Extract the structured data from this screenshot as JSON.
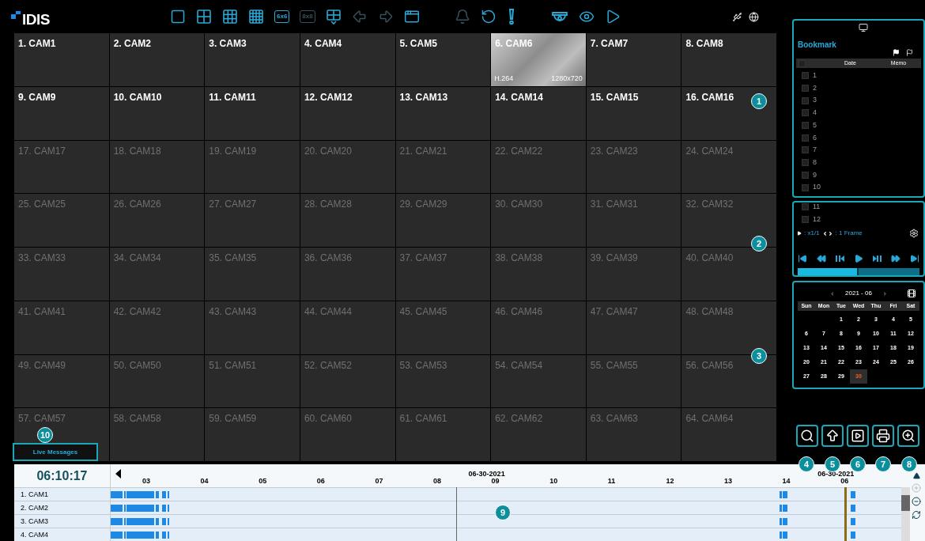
{
  "toolbar": {
    "logo": "IDIS",
    "groups": [
      [
        {
          "kind": "single",
          "disabled": false
        },
        {
          "kind": "quad",
          "disabled": false
        },
        {
          "kind": "grid9",
          "disabled": false
        },
        {
          "kind": "grid16",
          "disabled": false
        },
        {
          "kind": "label",
          "label": "6x6",
          "disabled": false
        },
        {
          "kind": "label",
          "label": "8x8",
          "disabled": true
        },
        {
          "kind": "custom",
          "disabled": false
        },
        {
          "kind": "prev",
          "disabled": true
        },
        {
          "kind": "next",
          "disabled": true
        },
        {
          "kind": "window",
          "disabled": false
        }
      ],
      [
        {
          "kind": "bell",
          "disabled": true
        },
        {
          "kind": "replay",
          "disabled": false
        },
        {
          "kind": "alert",
          "disabled": false
        }
      ],
      [
        {
          "kind": "dome",
          "disabled": false
        },
        {
          "kind": "eye",
          "disabled": false
        },
        {
          "kind": "play",
          "disabled": false
        }
      ]
    ]
  },
  "cameras": [
    {
      "name": "1. CAM1",
      "active": true
    },
    {
      "name": "2. CAM2",
      "active": true
    },
    {
      "name": "3. CAM3",
      "active": true
    },
    {
      "name": "4. CAM4",
      "active": true
    },
    {
      "name": "5. CAM5",
      "active": true
    },
    {
      "name": "6. CAM6",
      "active": true,
      "video": {
        "codec": "H.264",
        "resolution": "1280x720"
      }
    },
    {
      "name": "7. CAM7",
      "active": true
    },
    {
      "name": "8. CAM8",
      "active": true
    },
    {
      "name": "9. CAM9",
      "active": true
    },
    {
      "name": "10. CAM10",
      "active": true
    },
    {
      "name": "11. CAM11",
      "active": true
    },
    {
      "name": "12. CAM12",
      "active": true
    },
    {
      "name": "13. CAM13",
      "active": true
    },
    {
      "name": "14. CAM14",
      "active": true
    },
    {
      "name": "15. CAM15",
      "active": true
    },
    {
      "name": "16. CAM16",
      "active": true
    },
    {
      "name": "17. CAM17",
      "active": false
    },
    {
      "name": "18. CAM18",
      "active": false
    },
    {
      "name": "19. CAM19",
      "active": false
    },
    {
      "name": "20. CAM20",
      "active": false
    },
    {
      "name": "21. CAM21",
      "active": false
    },
    {
      "name": "22. CAM22",
      "active": false
    },
    {
      "name": "23. CAM23",
      "active": false
    },
    {
      "name": "24. CAM24",
      "active": false
    },
    {
      "name": "25. CAM25",
      "active": false
    },
    {
      "name": "26. CAM26",
      "active": false
    },
    {
      "name": "27. CAM27",
      "active": false
    },
    {
      "name": "28. CAM28",
      "active": false
    },
    {
      "name": "29. CAM29",
      "active": false
    },
    {
      "name": "30. CAM30",
      "active": false
    },
    {
      "name": "31. CAM31",
      "active": false
    },
    {
      "name": "32. CAM32",
      "active": false
    },
    {
      "name": "33. CAM33",
      "active": false
    },
    {
      "name": "34. CAM34",
      "active": false
    },
    {
      "name": "35. CAM35",
      "active": false
    },
    {
      "name": "36. CAM36",
      "active": false
    },
    {
      "name": "37. CAM37",
      "active": false
    },
    {
      "name": "38. CAM38",
      "active": false
    },
    {
      "name": "39. CAM39",
      "active": false
    },
    {
      "name": "40. CAM40",
      "active": false
    },
    {
      "name": "41. CAM41",
      "active": false
    },
    {
      "name": "42. CAM42",
      "active": false
    },
    {
      "name": "43. CAM43",
      "active": false
    },
    {
      "name": "44. CAM44",
      "active": false
    },
    {
      "name": "45. CAM45",
      "active": false
    },
    {
      "name": "46. CAM46",
      "active": false
    },
    {
      "name": "47. CAM47",
      "active": false
    },
    {
      "name": "48. CAM48",
      "active": false
    },
    {
      "name": "49. CAM49",
      "active": false
    },
    {
      "name": "50. CAM50",
      "active": false
    },
    {
      "name": "51. CAM51",
      "active": false
    },
    {
      "name": "52. CAM52",
      "active": false
    },
    {
      "name": "53. CAM53",
      "active": false
    },
    {
      "name": "54. CAM54",
      "active": false
    },
    {
      "name": "55. CAM55",
      "active": false
    },
    {
      "name": "56. CAM56",
      "active": false
    },
    {
      "name": "57. CAM57",
      "active": false
    },
    {
      "name": "58. CAM58",
      "active": false
    },
    {
      "name": "59. CAM59",
      "active": false
    },
    {
      "name": "60. CAM60",
      "active": false
    },
    {
      "name": "61. CAM61",
      "active": false
    },
    {
      "name": "62. CAM62",
      "active": false
    },
    {
      "name": "63. CAM63",
      "active": false
    },
    {
      "name": "64. CAM64",
      "active": false
    }
  ],
  "live_messages": {
    "label": "Live Messages"
  },
  "bookmark": {
    "title": "Bookmark",
    "all_checked": false,
    "columns": [
      "Date",
      "Memo"
    ],
    "rows": [
      {
        "label": "1",
        "checked": false
      },
      {
        "label": "2",
        "checked": false
      },
      {
        "label": "3",
        "checked": false
      },
      {
        "label": "4",
        "checked": false
      },
      {
        "label": "5",
        "checked": false
      },
      {
        "label": "6",
        "checked": false
      },
      {
        "label": "7",
        "checked": false
      },
      {
        "label": "8",
        "checked": false
      },
      {
        "label": "9",
        "checked": false
      },
      {
        "label": "10",
        "checked": false
      },
      {
        "label": "11",
        "checked": false
      },
      {
        "label": "12",
        "checked": false
      }
    ]
  },
  "playback": {
    "speed": ": x1/1",
    "step": ": 1 Frame",
    "level": 0.5
  },
  "calendar": {
    "month": "2021 - 06",
    "weekdays": [
      "Sun",
      "Mon",
      "Tue",
      "Wed",
      "Thu",
      "Fri",
      "Sat"
    ],
    "weeks": [
      [
        {
          "label": "1",
          "selected": false
        },
        {
          "label": "2",
          "selected": false
        },
        {
          "label": "3",
          "selected": false
        },
        {
          "label": "4",
          "selected": false
        },
        {
          "label": "5",
          "selected": false
        }
      ],
      [
        {
          "label": "6",
          "selected": false
        },
        {
          "label": "7",
          "selected": false
        },
        {
          "label": "8",
          "selected": false
        },
        {
          "label": "9",
          "selected": false
        },
        {
          "label": "10",
          "selected": false
        },
        {
          "label": "11",
          "selected": false
        },
        {
          "label": "12",
          "selected": false
        }
      ],
      [
        {
          "label": "13",
          "selected": false
        },
        {
          "label": "14",
          "selected": false
        },
        {
          "label": "15",
          "selected": false
        },
        {
          "label": "16",
          "selected": false
        },
        {
          "label": "17",
          "selected": false
        },
        {
          "label": "18",
          "selected": false
        },
        {
          "label": "19",
          "selected": false
        }
      ],
      [
        {
          "label": "20",
          "selected": false
        },
        {
          "label": "21",
          "selected": false
        },
        {
          "label": "22",
          "selected": false
        },
        {
          "label": "23",
          "selected": false
        },
        {
          "label": "24",
          "selected": false
        },
        {
          "label": "25",
          "selected": false
        },
        {
          "label": "26",
          "selected": false
        }
      ],
      [
        {
          "label": "27",
          "selected": false
        },
        {
          "label": "28",
          "selected": false
        },
        {
          "label": "29",
          "selected": false
        },
        {
          "label": "30",
          "selected": true
        }
      ]
    ]
  },
  "timeline": {
    "time": "06:10:17",
    "hours": [
      {
        "label": "03"
      },
      {
        "label": "04"
      },
      {
        "label": "05"
      },
      {
        "label": "06"
      },
      {
        "label": "07"
      },
      {
        "label": "08"
      },
      {
        "label": "09",
        "date": "06-30-2021"
      },
      {
        "label": "10"
      },
      {
        "label": "11"
      },
      {
        "label": "12"
      },
      {
        "label": "13"
      },
      {
        "label": "14"
      },
      {
        "label": "06",
        "date": "06-30-2021"
      }
    ],
    "rows": [
      "1. CAM1",
      "2. CAM2",
      "3. CAM3",
      "4. CAM4"
    ]
  },
  "callouts": [
    "1",
    "2",
    "3",
    "4",
    "5",
    "6",
    "7",
    "8",
    "9",
    "10"
  ]
}
